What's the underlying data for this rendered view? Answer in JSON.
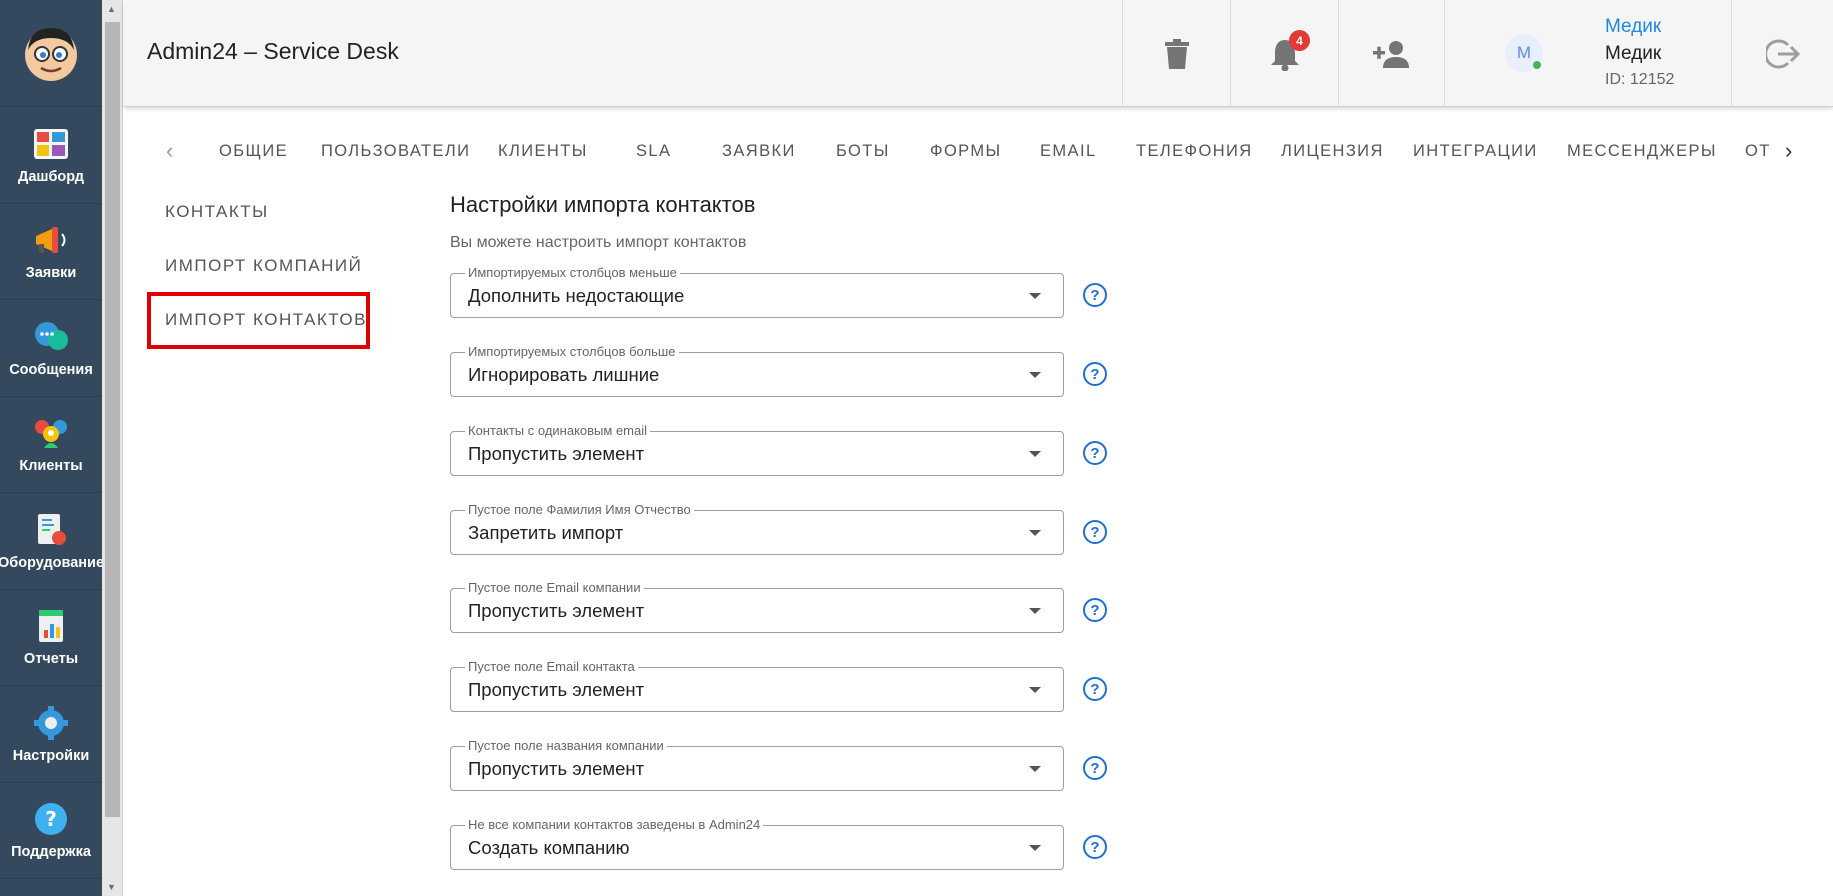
{
  "app": {
    "title": "Admin24 – Service Desk"
  },
  "sidebar": {
    "items": [
      {
        "label": "Дашборд",
        "icon": "dashboard-icon"
      },
      {
        "label": "Заявки",
        "icon": "megaphone-icon"
      },
      {
        "label": "Сообщения",
        "icon": "chat-icon"
      },
      {
        "label": "Клиенты",
        "icon": "clients-icon"
      },
      {
        "label": "Оборудование",
        "icon": "equipment-icon"
      },
      {
        "label": "Отчеты",
        "icon": "reports-icon"
      },
      {
        "label": "Настройки",
        "icon": "gear-icon"
      },
      {
        "label": "Поддержка",
        "icon": "help-icon"
      }
    ]
  },
  "topbar": {
    "notifications_count": "4",
    "user": {
      "link_name": "Медик",
      "name": "Медик",
      "id": "ID: 12152",
      "avatar_letter": "M"
    }
  },
  "tabs": {
    "items": [
      "ОБЩИЕ",
      "ПОЛЬЗОВАТЕЛИ",
      "КЛИЕНТЫ",
      "SLA",
      "ЗАЯВКИ",
      "БОТЫ",
      "ФОРМЫ",
      "EMAIL",
      "ТЕЛЕФОНИЯ",
      "ЛИЦЕНЗИЯ",
      "ИНТЕГРАЦИИ",
      "МЕССЕНДЖЕРЫ",
      "ОТ"
    ],
    "prev": "‹",
    "next": "›"
  },
  "subnav": {
    "items": [
      "КОНТАКТЫ",
      "ИМПОРТ КОМПАНИЙ",
      "ИМПОРТ КОНТАКТОВ"
    ],
    "active": "ИМПОРТ КОНТАКТОВ"
  },
  "main": {
    "title": "Настройки импорта контактов",
    "subtitle": "Вы можете настроить импорт контактов",
    "fields": [
      {
        "label": "Импортируемых столбцов меньше",
        "value": "Дополнить недостающие"
      },
      {
        "label": "Импортируемых столбцов больше",
        "value": "Игнорировать лишние"
      },
      {
        "label": "Контакты с одинаковым email",
        "value": "Пропустить элемент"
      },
      {
        "label": "Пустое поле Фамилия Имя Отчество",
        "value": "Запретить импорт"
      },
      {
        "label": "Пустое поле Email компании",
        "value": "Пропустить элемент"
      },
      {
        "label": "Пустое поле Email контакта",
        "value": "Пропустить элемент"
      },
      {
        "label": "Пустое поле названия компании",
        "value": "Пропустить элемент"
      },
      {
        "label": "Не все компании контактов заведены в Admin24",
        "value": "Создать компанию"
      }
    ],
    "help_glyph": "?"
  },
  "colors": {
    "sidebar": "#34495e",
    "accent": "#1e6fd0",
    "highlight": "#e00000",
    "badge": "#e53935"
  }
}
